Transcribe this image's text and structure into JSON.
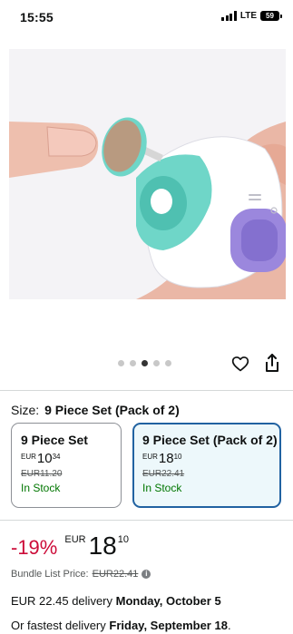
{
  "status_bar": {
    "time": "15:55",
    "network": "LTE",
    "battery": "59"
  },
  "gallery": {
    "image_alt": "Electric nail file device with sanding head held near fingertip",
    "dots_count": 5,
    "active_index": 2
  },
  "size": {
    "label": "Size:",
    "selected": "9 Piece Set (Pack of 2)"
  },
  "options": [
    {
      "title": "9 Piece Set",
      "currency": "EUR",
      "price_whole": "10",
      "price_fraction": "34",
      "list_price": "EUR11.20",
      "stock": "In Stock",
      "selected": false
    },
    {
      "title": "9 Piece Set (Pack of 2)",
      "currency": "EUR",
      "price_whole": "18",
      "price_fraction": "10",
      "list_price": "EUR22.41",
      "stock": "In Stock",
      "selected": true
    }
  ],
  "price": {
    "discount": "-19%",
    "currency": "EUR",
    "whole": "18",
    "fraction": "10"
  },
  "bundle": {
    "label": "Bundle List Price:",
    "list_price": "EUR22.41"
  },
  "delivery": {
    "line_prefix": "EUR 22.45 delivery",
    "date": "Monday, October 5"
  },
  "fastest": {
    "prefix": "Or fastest delivery",
    "date": "Friday, September 18",
    "suffix": "."
  },
  "colors": {
    "accent_blue": "#2162a1",
    "discount_red": "#cc0c39",
    "stock_green": "#007600",
    "device_teal": "#6fd6c8",
    "button_purple": "#9b87dd"
  }
}
